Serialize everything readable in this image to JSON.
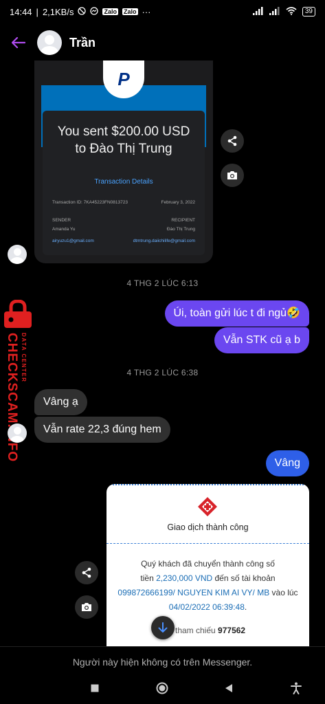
{
  "status_bar": {
    "time": "14:44",
    "speed": "2,1KB/s",
    "app_icons": [
      "mute-icon",
      "messenger-icon",
      "zalo-icon",
      "zalo-icon"
    ],
    "zalo_label": "Zalo",
    "more": "···",
    "battery": "39"
  },
  "header": {
    "contact_name": "Trần"
  },
  "paypal_receipt": {
    "logo": "P",
    "sent_line1": "You sent $200.00 USD",
    "sent_line2": "to Đào Thị Trung",
    "details_link": "Transaction Details",
    "transaction_id": "Transaction ID: 7KA45223FN0813723",
    "date": "February 3, 2022",
    "sender_label": "SENDER",
    "recipient_label": "RECIPIENT",
    "sender_name": "Amanda Yu",
    "recipient_name": "Đào Thị Trung",
    "sender_email": "airyuzu1@gmail.com",
    "recipient_email": "dtmtrung.daiichilife@gmail.com"
  },
  "timestamps": {
    "t1": "4 THG 2 LÚC 6:13",
    "t2": "4 THG 2 LÚC 6:38"
  },
  "messages": {
    "out1": "Úi, toàn gửi lúc t đi ngủ🤣",
    "out2": "Vẫn STK cũ ạ b",
    "in1": "Vâng ạ",
    "in2": "Vẫn rate 22,3 đúng hem",
    "out3": "Vâng"
  },
  "watermark": {
    "main": "CHECKSCAM.INFO",
    "sub": "DATA CENTER"
  },
  "bank_receipt": {
    "title": "Giao dịch thành công",
    "line1": "Quý khách đã chuyển thành công số",
    "line2_prefix": "tiền ",
    "amount": "2,230,000 VND",
    "line2_suffix": " đến số tài khoản",
    "account": "099872666199/ NGUYEN KIM AI VY/ MB",
    "line3_suffix": " vào lúc",
    "datetime": "04/02/2022 06:39:48",
    "period": ".",
    "ref_label": "tham chiếu ",
    "ref_value": "977562"
  },
  "notice": "Người này hiện không có trên Messenger.",
  "colors": {
    "accent": "#6b47f0",
    "outgoing_blue": "#2e5fe8",
    "incoming": "#303030",
    "watermark": "#e02020"
  }
}
